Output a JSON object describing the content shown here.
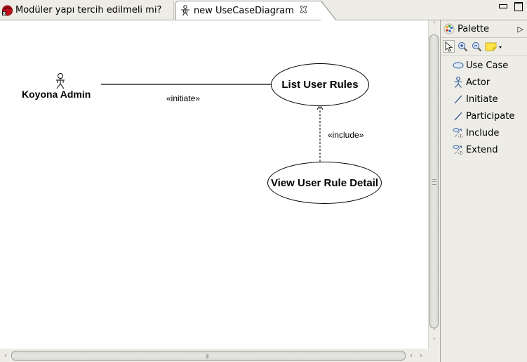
{
  "tabs": [
    {
      "label": "Modüler yapı tercih edilmeli mi?",
      "icon": "bug-report-icon",
      "active": false
    },
    {
      "label": "new UseCaseDiagram",
      "icon": "actor-icon",
      "active": true,
      "close_icon": "close-icon"
    }
  ],
  "window_controls": {
    "minimize": "minimize-icon",
    "maximize": "maximize-icon"
  },
  "diagram": {
    "actor": {
      "name": "Koyona Admin"
    },
    "use_cases": [
      {
        "id": "list",
        "name": "List User Rules"
      },
      {
        "id": "view",
        "name": "View User Rule Detail"
      }
    ],
    "relations": [
      {
        "from": "Koyona Admin",
        "to": "List User Rules",
        "type": "initiate",
        "label": "«initiate»"
      },
      {
        "from": "View User Rule Detail",
        "to": "List User Rules",
        "type": "include",
        "label": "«include»"
      }
    ]
  },
  "palette": {
    "title": "Palette",
    "toggle_glyph": "▷",
    "tools": [
      {
        "name": "select-tool",
        "icon": "pointer-icon",
        "selected": true
      },
      {
        "name": "zoom-in-tool",
        "icon": "zoom-in-icon"
      },
      {
        "name": "zoom-out-tool",
        "icon": "zoom-out-icon"
      },
      {
        "name": "note-tool",
        "icon": "note-icon",
        "has_dropdown": true
      }
    ],
    "items": [
      {
        "label": "Use Case",
        "icon": "use-case-icon"
      },
      {
        "label": "Actor",
        "icon": "actor-icon"
      },
      {
        "label": "Initiate",
        "icon": "line-icon"
      },
      {
        "label": "Participate",
        "icon": "line-icon"
      },
      {
        "label": "Include",
        "icon": "include-icon"
      },
      {
        "label": "Extend",
        "icon": "extend-icon"
      }
    ]
  },
  "scroll": {
    "h_grip": "III"
  }
}
